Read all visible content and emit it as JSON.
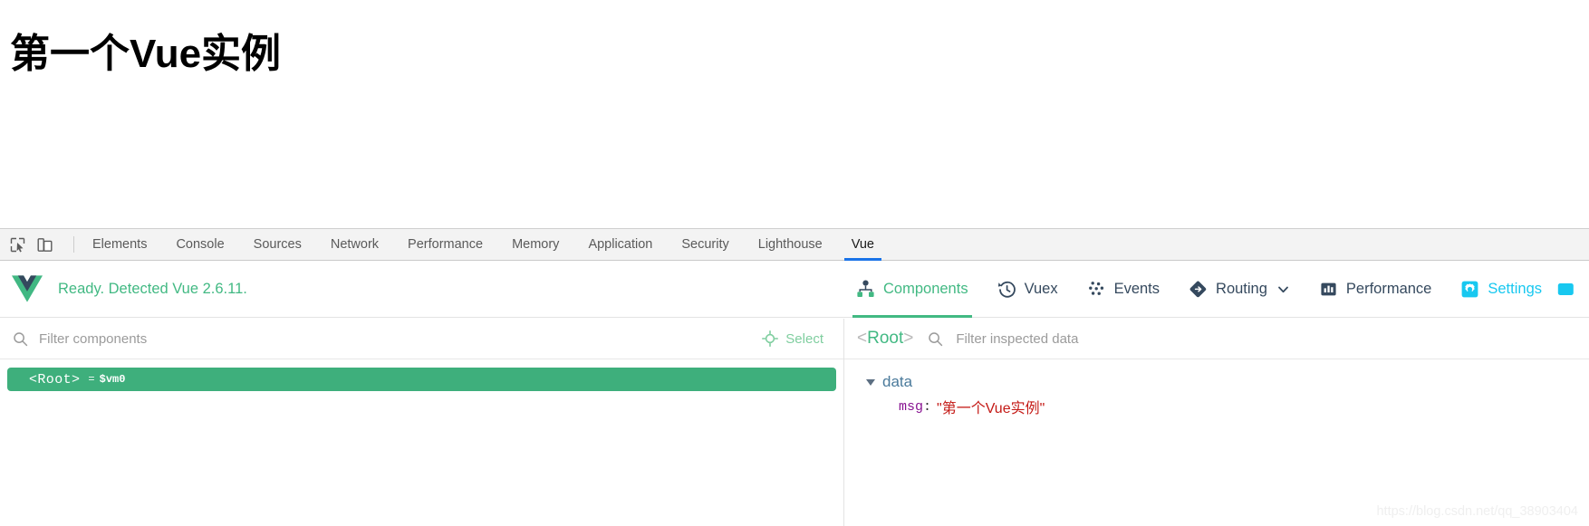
{
  "page": {
    "heading": "第一个Vue实例"
  },
  "devtools": {
    "toolbar_icons": [
      {
        "name": "inspect-element-icon",
        "title": "Inspect element"
      },
      {
        "name": "device-toolbar-icon",
        "title": "Toggle device toolbar"
      }
    ],
    "tabs": [
      {
        "label": "Elements",
        "active": false
      },
      {
        "label": "Console",
        "active": false
      },
      {
        "label": "Sources",
        "active": false
      },
      {
        "label": "Network",
        "active": false
      },
      {
        "label": "Performance",
        "active": false
      },
      {
        "label": "Memory",
        "active": false
      },
      {
        "label": "Application",
        "active": false
      },
      {
        "label": "Security",
        "active": false
      },
      {
        "label": "Lighthouse",
        "active": false
      },
      {
        "label": "Vue",
        "active": true
      }
    ],
    "active_tab_underline_color": "#1a73e8"
  },
  "vue_devtools": {
    "status_text": "Ready. Detected Vue 2.6.11.",
    "status_color": "#42b983",
    "logo_name": "vue-logo-icon",
    "nav": [
      {
        "label": "Components",
        "icon": "components-tree-icon",
        "active": true
      },
      {
        "label": "Vuex",
        "icon": "vuex-history-clock-icon",
        "active": false
      },
      {
        "label": "Events",
        "icon": "events-dots-icon",
        "active": false
      },
      {
        "label": "Routing",
        "icon": "routing-diamond-icon",
        "active": false,
        "has_chevron": true
      },
      {
        "label": "Performance",
        "icon": "performance-bars-icon",
        "active": false
      },
      {
        "label": "Settings",
        "icon": "settings-gear-icon",
        "active": false,
        "color": "#18c8f0"
      }
    ]
  },
  "components_pane": {
    "filter_placeholder": "Filter components",
    "filter_value": "",
    "search_icon": "search-icon",
    "select_button": {
      "label": "Select",
      "icon": "crosshair-target-icon",
      "color": "#7fce9f"
    },
    "tree": [
      {
        "name": "<Root>",
        "equals": "=",
        "instance": "$vm0",
        "selected": true
      }
    ]
  },
  "inspector_pane": {
    "bracket_open": "<",
    "component_name": "Root",
    "bracket_close": ">",
    "filter_placeholder": "Filter inspected data",
    "filter_value": "",
    "search_icon": "search-icon",
    "groups": [
      {
        "label": "data",
        "expanded": true,
        "rows": [
          {
            "key": "msg",
            "separator": ":",
            "value": "\"第一个Vue实例\"",
            "value_type": "string"
          }
        ]
      }
    ]
  },
  "watermark": {
    "text": "https://blog.csdn.net/qq_38903404"
  }
}
